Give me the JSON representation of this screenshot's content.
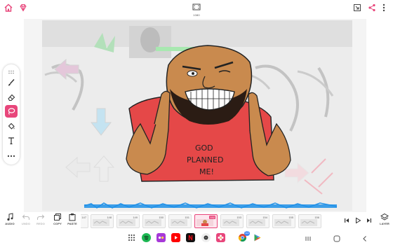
{
  "header": {
    "home_icon": "home-icon",
    "premium_icon": "gem-icon",
    "canvas_size_label": "1080",
    "fit_icon": "fit-screen-icon",
    "share_icon": "share-icon",
    "more_icon": "more-vert-icon"
  },
  "colors": {
    "accent": "#e8467b",
    "wave": "#1e90e8",
    "shirt": "#e54848",
    "skin": "#c98a4e"
  },
  "tools": [
    {
      "name": "brush",
      "icon": "brush-icon",
      "active": false
    },
    {
      "name": "eraser",
      "icon": "eraser-icon",
      "active": false
    },
    {
      "name": "lasso",
      "icon": "lasso-icon",
      "active": true
    },
    {
      "name": "fill",
      "icon": "paint-bucket-icon",
      "active": false
    },
    {
      "name": "text",
      "icon": "text-icon",
      "active": false
    },
    {
      "name": "more",
      "icon": "more-horiz-icon",
      "active": false
    }
  ],
  "canvas": {
    "shirt_text_line1": "GOD",
    "shirt_text_line2": "PLANNED",
    "shirt_text_line3": "ME!"
  },
  "timeline": {
    "audio_label": "AUDIO",
    "undo_label": "UNDO",
    "redo_label": "REDO",
    "copy_label": "COPY",
    "paste_label": "PASTE",
    "layer_label": "LAYER",
    "frames": [
      "147",
      "148",
      "149",
      "150",
      "151",
      "152",
      "153",
      "154",
      "155",
      "156"
    ],
    "current_frame": "152"
  },
  "navbar": {
    "apps": [
      "grid-apps-icon",
      "spotify-icon",
      "game-app-icon",
      "youtube-icon",
      "netflix-icon",
      "camera-icon",
      "flower-app-icon",
      "chrome-icon",
      "play-store-icon"
    ],
    "chrome_badge": "11"
  }
}
